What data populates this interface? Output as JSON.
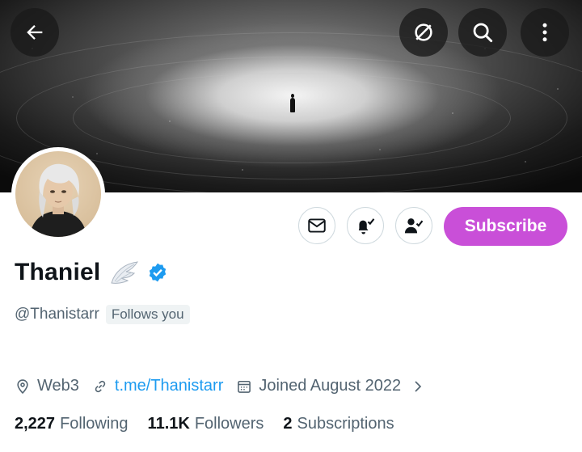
{
  "profile": {
    "name": "Thaniel",
    "handle": "@Thanistarr",
    "follows_you": "Follows you",
    "subscribe_label": "Subscribe",
    "location": "Web3",
    "website": "t.me/Thanistarr",
    "joined": "Joined August 2022"
  },
  "stats": {
    "following_count": "2,227",
    "following_label": "Following",
    "followers_count": "11.1K",
    "followers_label": "Followers",
    "subscriptions_count": "2",
    "subscriptions_label": "Subscriptions"
  },
  "icons": {
    "back": "arrow-left-icon",
    "grok": "slashed-circle-icon",
    "search": "search-icon",
    "more": "vertical-ellipsis-icon",
    "message": "envelope-icon",
    "notifications": "bell-check-icon",
    "following": "person-check-icon",
    "verified": "verified-badge-icon",
    "emoji": "wing-emoji-icon",
    "location": "location-pin-icon",
    "link": "link-icon",
    "calendar": "calendar-icon",
    "chevron": "chevron-right-icon"
  },
  "colors": {
    "accent_subscribe": "#c94fd8",
    "link": "#1d9bf0",
    "verified": "#1d9bf0",
    "secondary_text": "#536471"
  }
}
